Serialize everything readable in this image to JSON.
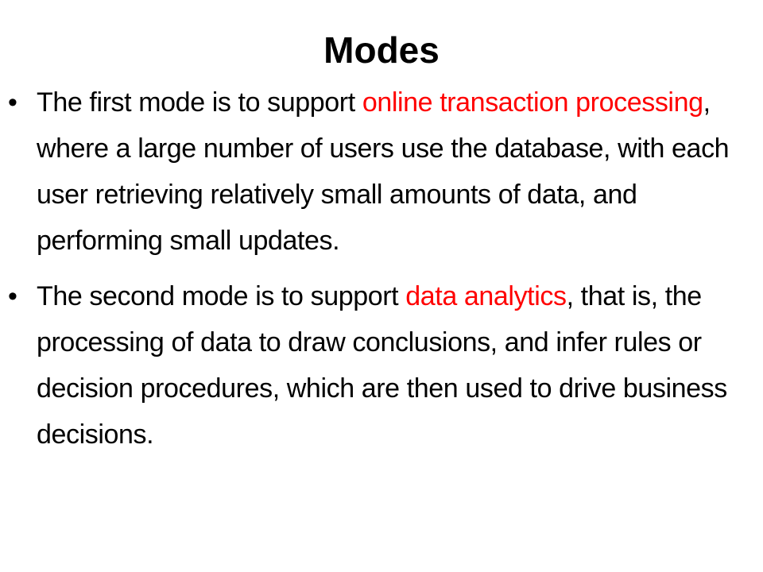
{
  "slide": {
    "title": "Modes",
    "bullet_symbol": "•",
    "highlight_color": "#ff0000",
    "bullets": [
      {
        "before": "The first mode is to support ",
        "highlight": "online transaction processing",
        "after": ", where a large number of users use the database, with each user retrieving relatively small amounts of data, and performing small updates."
      },
      {
        "before": "The second mode is to support ",
        "highlight": "data analytics",
        "after": ", that is, the processing of data to draw conclusions, and infer rules or decision procedures, which are then used to drive business decisions."
      }
    ]
  }
}
